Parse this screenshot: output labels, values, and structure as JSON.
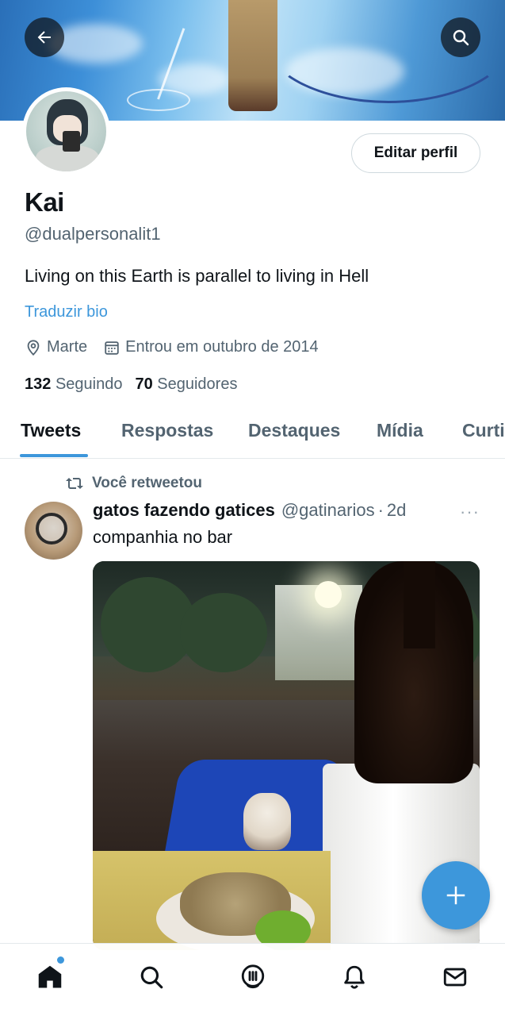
{
  "profile": {
    "name": "Kai",
    "handle": "@dualpersonalit1",
    "bio": "Living on this Earth is parallel to living in Hell",
    "translate_bio": "Traduzir bio",
    "location": "Marte",
    "joined": "Entrou em outubro de 2014",
    "following_count": "132",
    "following_label": "Seguindo",
    "followers_count": "70",
    "followers_label": "Seguidores",
    "edit_button": "Editar perfil"
  },
  "tabs": [
    {
      "label": "Tweets",
      "active": true
    },
    {
      "label": "Respostas",
      "active": false
    },
    {
      "label": "Destaques",
      "active": false
    },
    {
      "label": "Mídia",
      "active": false
    },
    {
      "label": "Curti",
      "active": false
    }
  ],
  "tweet": {
    "retweet_label": "Você retweetou",
    "author": "gatos fazendo gatices",
    "author_handle": "@gatinarios",
    "separator": "·",
    "time": "2d",
    "more": "···",
    "text": "companhia no bar"
  },
  "icons": {
    "back": "arrow-left-icon",
    "search": "search-icon",
    "location": "location-pin-icon",
    "calendar": "calendar-icon",
    "retweet": "retweet-icon",
    "compose": "plus-icon",
    "nav_home": "home-icon",
    "nav_search": "search-icon",
    "nav_spaces": "spaces-icon",
    "nav_notifications": "bell-icon",
    "nav_messages": "mail-icon"
  },
  "colors": {
    "accent": "#3d97db",
    "text": "#0f1419",
    "muted": "#536471"
  }
}
